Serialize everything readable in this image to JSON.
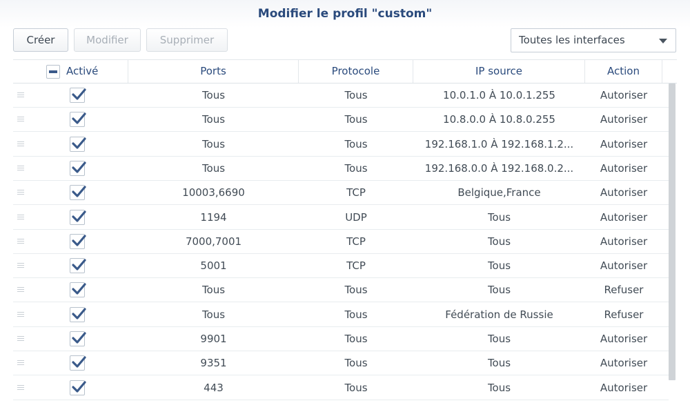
{
  "dialog": {
    "title": "Modifier le profil \"custom\""
  },
  "toolbar": {
    "create_label": "Créer",
    "modify_label": "Modifier",
    "delete_label": "Supprimer",
    "interface_select": "Toutes les interfaces"
  },
  "columns": {
    "enabled": "Activé",
    "ports": "Ports",
    "protocol": "Protocole",
    "source_ip": "IP source",
    "action": "Action"
  },
  "rules": [
    {
      "enabled": true,
      "ports": "Tous",
      "protocol": "Tous",
      "source_ip": "10.0.1.0 À 10.0.1.255",
      "action": "Autoriser"
    },
    {
      "enabled": true,
      "ports": "Tous",
      "protocol": "Tous",
      "source_ip": "10.8.0.0 À 10.8.0.255",
      "action": "Autoriser"
    },
    {
      "enabled": true,
      "ports": "Tous",
      "protocol": "Tous",
      "source_ip": "192.168.1.0 À 192.168.1.2...",
      "action": "Autoriser"
    },
    {
      "enabled": true,
      "ports": "Tous",
      "protocol": "Tous",
      "source_ip": "192.168.0.0 À 192.168.0.2...",
      "action": "Autoriser"
    },
    {
      "enabled": true,
      "ports": "10003,6690",
      "protocol": "TCP",
      "source_ip": "Belgique,France",
      "action": "Autoriser"
    },
    {
      "enabled": true,
      "ports": "1194",
      "protocol": "UDP",
      "source_ip": "Tous",
      "action": "Autoriser"
    },
    {
      "enabled": true,
      "ports": "7000,7001",
      "protocol": "TCP",
      "source_ip": "Tous",
      "action": "Autoriser"
    },
    {
      "enabled": true,
      "ports": "5001",
      "protocol": "TCP",
      "source_ip": "Tous",
      "action": "Autoriser"
    },
    {
      "enabled": true,
      "ports": "Tous",
      "protocol": "Tous",
      "source_ip": "Tous",
      "action": "Refuser"
    },
    {
      "enabled": true,
      "ports": "Tous",
      "protocol": "Tous",
      "source_ip": "Fédération de Russie",
      "action": "Refuser"
    },
    {
      "enabled": true,
      "ports": "9901",
      "protocol": "Tous",
      "source_ip": "Tous",
      "action": "Autoriser"
    },
    {
      "enabled": true,
      "ports": "9351",
      "protocol": "Tous",
      "source_ip": "Tous",
      "action": "Autoriser"
    },
    {
      "enabled": true,
      "ports": "443",
      "protocol": "Tous",
      "source_ip": "Tous",
      "action": "Autoriser"
    }
  ],
  "colors": {
    "title": "#2a4a7c",
    "header_text": "#2a4a7c",
    "checkmark": "#3a5a8a",
    "scrollbar": "#cfd3d7"
  },
  "icons": {
    "row_handle": "drag-handle-icon",
    "check": "checkmark-icon",
    "dropdown": "chevron-down-icon"
  }
}
